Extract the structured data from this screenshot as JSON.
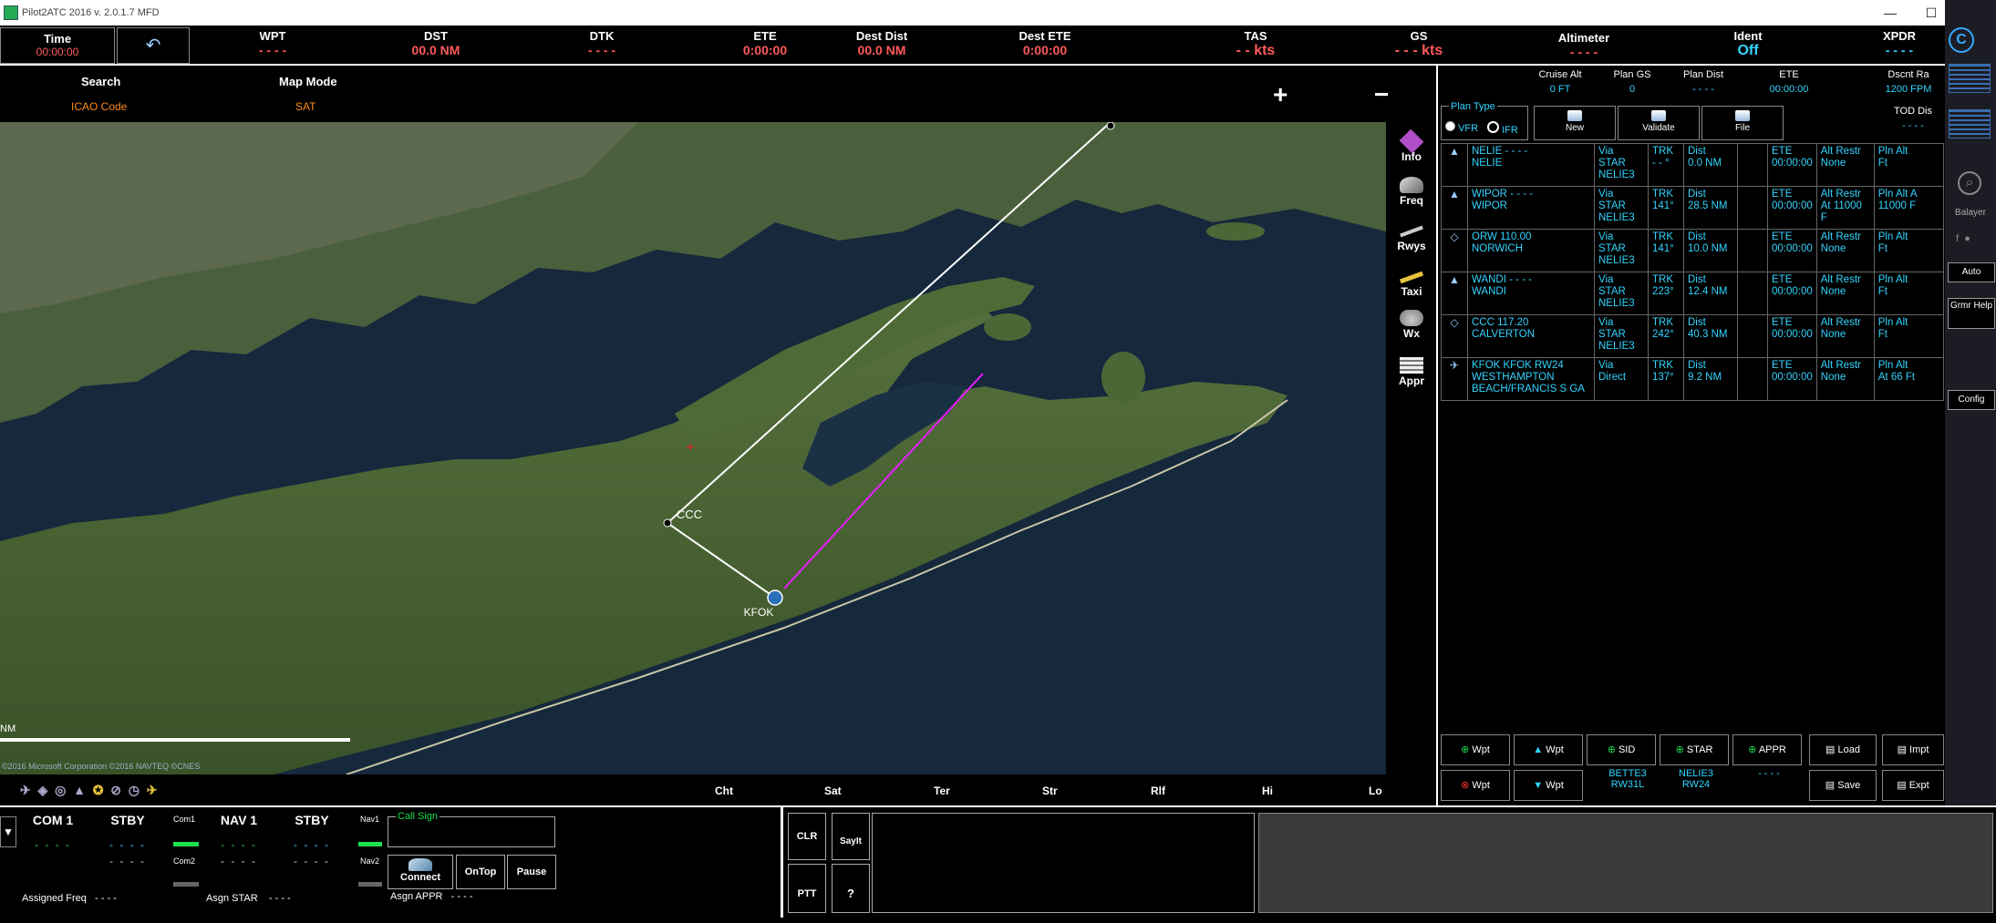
{
  "window": {
    "title": "Pilot2ATC 2016 v. 2.0.1.7 MFD",
    "buttons": [
      "—",
      "☐",
      "✕"
    ]
  },
  "top_bar": {
    "time": {
      "label": "Time",
      "value": "00:00:00"
    },
    "instruments": [
      {
        "label": "WPT",
        "value": "- - - -"
      },
      {
        "label": "DST",
        "value": "00.0 NM"
      },
      {
        "label": "DTK",
        "value": "- - - -"
      },
      {
        "label": "ETE",
        "value": "0:00:00"
      },
      {
        "label": "Dest Dist",
        "value": "00.0 NM"
      },
      {
        "label": "Dest ETE",
        "value": "0:00:00"
      },
      {
        "label": "TAS",
        "value": "- - kts"
      },
      {
        "label": "GS",
        "value": "- - - kts"
      },
      {
        "label": "Altimeter",
        "value": "- - - -"
      },
      {
        "label": "Ident",
        "value": "Off"
      },
      {
        "label": "XPDR",
        "value": "- - - -"
      }
    ]
  },
  "map_header": {
    "search_label": "Search",
    "search_value": "ICAO Code",
    "map_mode_label": "Map Mode",
    "map_mode_value": "SAT",
    "zoom_in": "+",
    "zoom_out": "−"
  },
  "map": {
    "labels": {
      "ccc": "CCC",
      "kfok": "KFOK",
      "nm": "NM"
    },
    "copyright": "©2016 Microsoft Corporation ©2016 NAVTEQ ©CNES"
  },
  "map_tools": [
    {
      "label": "Info",
      "icon": "info-icon"
    },
    {
      "label": "Freq",
      "icon": "frequency-icon"
    },
    {
      "label": "Rwys",
      "icon": "runway-icon"
    },
    {
      "label": "Taxi",
      "icon": "taxi-icon"
    },
    {
      "label": "Wx",
      "icon": "weather-icon"
    },
    {
      "label": "Appr",
      "icon": "approach-icon"
    }
  ],
  "map_footer": [
    "Cht",
    "Sat",
    "Ter",
    "Str",
    "Rlf",
    "Hi",
    "Lo"
  ],
  "flight_plan": {
    "headers": [
      {
        "label": "Cruise Alt",
        "value": "0 FT"
      },
      {
        "label": "Plan GS",
        "value": "0"
      },
      {
        "label": "Plan Dist",
        "value": "- - - -"
      },
      {
        "label": "ETE",
        "value": "00:00:00"
      },
      {
        "label": "Dscnt Ra",
        "value": "1200 FPM"
      }
    ],
    "tod_label": "TOD Dis",
    "tod_value": "- - - -",
    "plan_type_label": "Plan Type",
    "vfr": "VFR",
    "ifr": "IFR",
    "buttons": [
      "New",
      "Validate",
      "File"
    ],
    "rows": [
      {
        "icon": "▲",
        "wpt1": "NELIE   - - - -",
        "wpt2": "NELIE",
        "wpt3": "",
        "via1": "Via",
        "via2": "STAR",
        "via3": "NELIE3",
        "trk1": "TRK",
        "trk2": "- - °",
        "dist1": "Dist",
        "dist2": "0.0 NM",
        "ete1": "ETE",
        "ete2": "00:00:00",
        "alt1": "Alt Restr",
        "alt2": "None",
        "pln1": "Pln Alt",
        "pln2": "Ft"
      },
      {
        "icon": "▲",
        "wpt1": "WIPOR   - - - -",
        "wpt2": "WIPOR",
        "wpt3": "",
        "via1": "Via",
        "via2": "STAR",
        "via3": "NELIE3",
        "trk1": "TRK",
        "trk2": "141°",
        "dist1": "Dist",
        "dist2": "28.5 NM",
        "ete1": "ETE",
        "ete2": "00:00:00",
        "alt1": "Alt Restr",
        "alt2": "At 11000 F",
        "pln1": "Pln Alt A",
        "pln2": "11000 F"
      },
      {
        "icon": "◇",
        "wpt1": "ORW   110.00",
        "wpt2": "NORWICH",
        "wpt3": "",
        "via1": "Via",
        "via2": "STAR",
        "via3": "NELIE3",
        "trk1": "TRK",
        "trk2": "141°",
        "dist1": "Dist",
        "dist2": "10.0 NM",
        "ete1": "ETE",
        "ete2": "00:00:00",
        "alt1": "Alt Restr",
        "alt2": "None",
        "pln1": "Pln Alt",
        "pln2": "Ft"
      },
      {
        "icon": "▲",
        "wpt1": "WANDI   - - - -",
        "wpt2": "WANDI",
        "wpt3": "",
        "via1": "Via",
        "via2": "STAR",
        "via3": "NELIE3",
        "trk1": "TRK",
        "trk2": "223°",
        "dist1": "Dist",
        "dist2": "12.4 NM",
        "ete1": "ETE",
        "ete2": "00:00:00",
        "alt1": "Alt Restr",
        "alt2": "None",
        "pln1": "Pln Alt",
        "pln2": "Ft"
      },
      {
        "icon": "◇",
        "wpt1": "CCC   117.20",
        "wpt2": "CALVERTON",
        "wpt3": "",
        "via1": "Via",
        "via2": "STAR",
        "via3": "NELIE3",
        "trk1": "TRK",
        "trk2": "242°",
        "dist1": "Dist",
        "dist2": "40.3 NM",
        "ete1": "ETE",
        "ete2": "00:00:00",
        "alt1": "Alt Restr",
        "alt2": "None",
        "pln1": "Pln Alt",
        "pln2": "Ft"
      },
      {
        "icon": "✈",
        "wpt1": "KFOK   KFOK RW24",
        "wpt2": "WESTHAMPTON",
        "wpt3": "BEACH/FRANCIS S GA",
        "via1": "Via",
        "via2": "Direct",
        "via3": "",
        "trk1": "TRK",
        "trk2": "137°",
        "dist1": "Dist",
        "dist2": "9.2 NM",
        "ete1": "ETE",
        "ete2": "00:00:00",
        "alt1": "Alt Restr",
        "alt2": "None",
        "pln1": "Pln Alt",
        "pln2": "At 66 Ft"
      }
    ],
    "bottom_row1": [
      "Wpt",
      "Wpt",
      "SID",
      "STAR",
      "APPR",
      "Load",
      "Impt"
    ],
    "bottom_row2": [
      "Wpt",
      "Wpt",
      "Save",
      "Expt"
    ],
    "sid_info": "BETTE3",
    "sid_rwy": "RW31L",
    "star_info": "NELIE3",
    "star_rwy": "RW24",
    "appr_info": "- - - -"
  },
  "sidebar": {
    "user": "Balayer",
    "buttons": [
      "Auto",
      "Grmr Help",
      "Config"
    ]
  },
  "radios": {
    "com1": "COM 1",
    "stby1": "STBY",
    "nav1": "NAV 1",
    "stby2": "STBY",
    "com1_small": "Com1",
    "com2_small": "Com2",
    "nav1_small": "Nav1",
    "nav2_small": "Nav2",
    "dash": "- - - -",
    "assigned_freq_label": "Assigned Freq",
    "assigned_freq_value": "- - - -",
    "asgn_star_label": "Asgn STAR",
    "asgn_star_value": "- - - -",
    "asgn_appr_label": "Asgn APPR",
    "asgn_appr_value": "- - - -",
    "callsign_label": "Call Sign",
    "connect": "Connect",
    "ontop": "OnTop",
    "pause": "Pause"
  },
  "atc": {
    "clr": "CLR",
    "sayit": "SayIt",
    "ptt": "PTT",
    "help": "?"
  },
  "colors": {
    "value_red": "#ff5a5a",
    "value_cyan": "#33d4ff",
    "route_white": "#ffffff",
    "route_magenta": "#e81cff",
    "water": "#152a3f",
    "land": "#3f5a2c"
  }
}
